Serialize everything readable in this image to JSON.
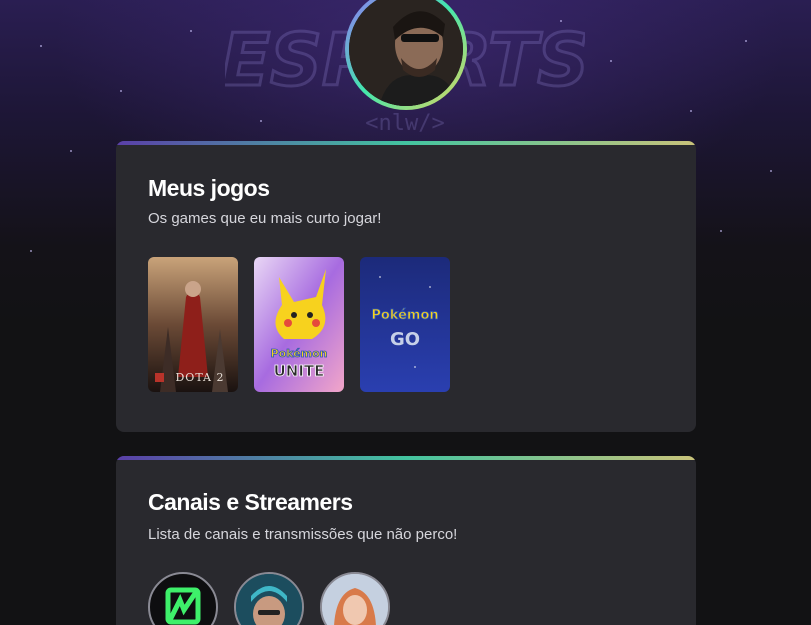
{
  "profile": {
    "avatar_icon": "user-photo"
  },
  "background": {
    "logo_text": "ESPORTS",
    "logo_subtext": "<nlw/>"
  },
  "games_section": {
    "title": "Meus jogos",
    "subtitle": "Os games que eu mais curto jogar!",
    "games": [
      {
        "name": "DOTA 2"
      },
      {
        "name_top": "Pokémon",
        "name_bottom": "UNITE"
      },
      {
        "name_top": "Pokémon",
        "name_bottom": "GO"
      }
    ]
  },
  "channels_section": {
    "title": "Canais e Streamers",
    "subtitle": "Lista de canais e transmissões que não perco!",
    "channels": [
      {
        "icon": "green-logo-icon"
      },
      {
        "icon": "streamer-avatar"
      },
      {
        "icon": "streamer-avatar"
      }
    ]
  },
  "colors": {
    "card_bg": "#29292e",
    "page_bg": "#121214",
    "accent_purple": "#9572fc",
    "accent_green": "#43e7ad",
    "accent_yellow": "#e2d45c"
  }
}
